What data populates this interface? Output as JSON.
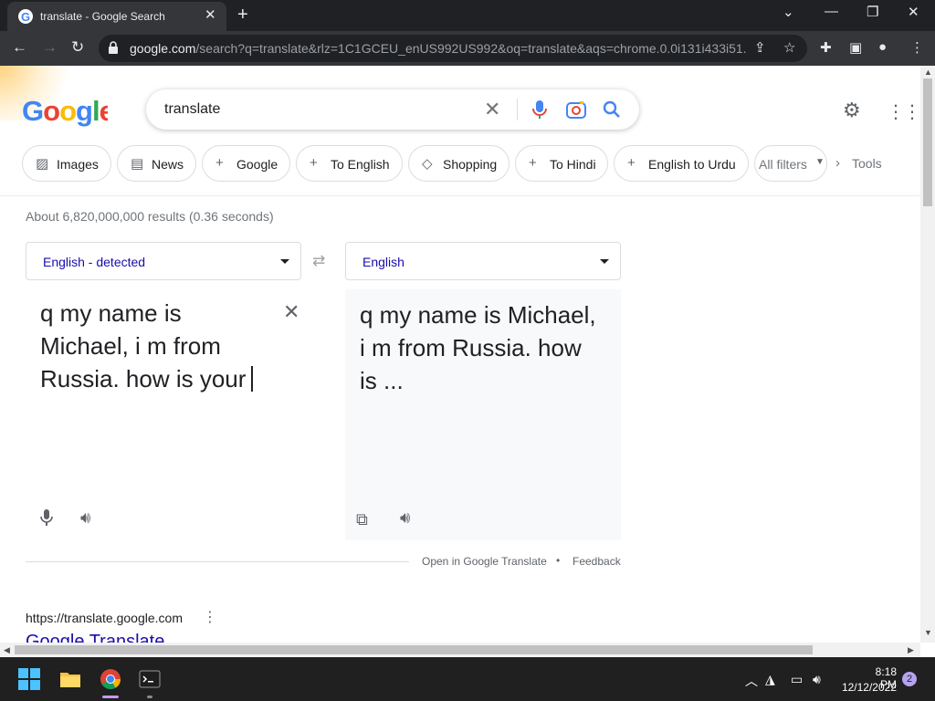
{
  "browser": {
    "tab_title": "translate - Google Search",
    "url_host": "google.com",
    "url_rest": "/search?q=translate&rlz=1C1GCEU_enUS992US992&oq=translate&aqs=chrome.0.0i131i433i51..."
  },
  "search": {
    "query": "translate",
    "logo": "Google"
  },
  "chips": [
    {
      "label": "Images"
    },
    {
      "label": "News"
    },
    {
      "label": "Google"
    },
    {
      "label": "To English"
    },
    {
      "label": "Shopping"
    },
    {
      "label": "To Hindi"
    },
    {
      "label": "English to Urdu"
    },
    {
      "label": "All filters"
    }
  ],
  "tools_label": "Tools",
  "results_stats": "About 6,820,000,000 results (0.36 seconds)",
  "translate": {
    "source_lang": "English - detected",
    "target_lang": "English",
    "source_text": "q my name is Michael, i m from Russia. how is your",
    "target_text": "q my name is Michael, i m from Russia. how is ...",
    "open_link": "Open in Google Translate",
    "feedback": "Feedback"
  },
  "result": {
    "cite": "https://translate.google.com",
    "title": "Google Translate"
  },
  "taskbar": {
    "time": "8:18 PM",
    "date": "12/12/2022",
    "notifications": "2"
  },
  "colors": {
    "link": "#1a0dab",
    "chrome_dark": "#202124",
    "taskbar": "#202020"
  }
}
